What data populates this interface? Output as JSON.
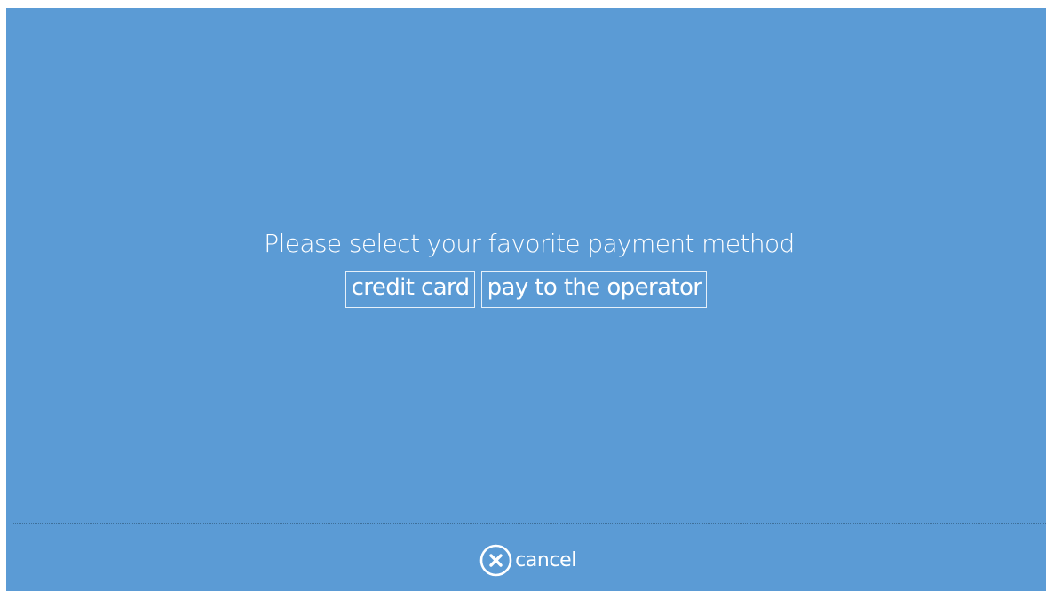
{
  "dialog": {
    "prompt": "Please select your favorite payment method",
    "options": [
      {
        "label": "credit card"
      },
      {
        "label": "pay to the operator"
      }
    ]
  },
  "footer": {
    "cancel_label": "cancel",
    "cancel_icon": "close-circle-icon"
  },
  "colors": {
    "background": "#5b9bd5",
    "text": "#ffffff"
  }
}
